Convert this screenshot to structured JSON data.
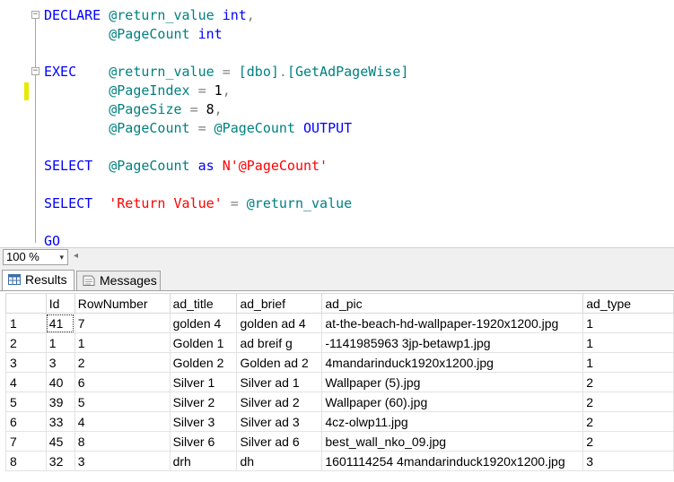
{
  "editor": {
    "lines": [
      {
        "parts": [
          [
            "kw",
            "DECLARE"
          ],
          [
            "t",
            " "
          ],
          [
            "var",
            "@return_value"
          ],
          [
            "t",
            " "
          ],
          [
            "kw",
            "int"
          ],
          [
            "gray",
            ","
          ]
        ]
      },
      {
        "parts": [
          [
            "t",
            "        "
          ],
          [
            "var",
            "@PageCount"
          ],
          [
            "t",
            " "
          ],
          [
            "kw",
            "int"
          ]
        ]
      },
      {
        "parts": [
          [
            "t",
            ""
          ]
        ]
      },
      {
        "parts": [
          [
            "kw",
            "EXEC"
          ],
          [
            "t",
            "    "
          ],
          [
            "var",
            "@return_value"
          ],
          [
            "t",
            " "
          ],
          [
            "gray",
            "="
          ],
          [
            "t",
            " "
          ],
          [
            "var",
            "[dbo]"
          ],
          [
            "gray",
            "."
          ],
          [
            "var",
            "[GetAdPageWise]"
          ]
        ]
      },
      {
        "parts": [
          [
            "t",
            "        "
          ],
          [
            "var",
            "@PageIndex"
          ],
          [
            "t",
            " "
          ],
          [
            "gray",
            "="
          ],
          [
            "t",
            " 1"
          ],
          [
            "gray",
            ","
          ]
        ]
      },
      {
        "parts": [
          [
            "t",
            "        "
          ],
          [
            "var",
            "@PageSize"
          ],
          [
            "t",
            " "
          ],
          [
            "gray",
            "="
          ],
          [
            "t",
            " 8"
          ],
          [
            "gray",
            ","
          ]
        ]
      },
      {
        "parts": [
          [
            "t",
            "        "
          ],
          [
            "var",
            "@PageCount"
          ],
          [
            "t",
            " "
          ],
          [
            "gray",
            "="
          ],
          [
            "t",
            " "
          ],
          [
            "var",
            "@PageCount"
          ],
          [
            "t",
            " "
          ],
          [
            "kw",
            "OUTPUT"
          ]
        ]
      },
      {
        "parts": [
          [
            "t",
            ""
          ]
        ]
      },
      {
        "parts": [
          [
            "kw",
            "SELECT"
          ],
          [
            "t",
            "  "
          ],
          [
            "var",
            "@PageCount"
          ],
          [
            "t",
            " "
          ],
          [
            "kw",
            "as"
          ],
          [
            "t",
            " "
          ],
          [
            "str",
            "N'@PageCount'"
          ]
        ]
      },
      {
        "parts": [
          [
            "t",
            ""
          ]
        ]
      },
      {
        "parts": [
          [
            "kw",
            "SELECT"
          ],
          [
            "t",
            "  "
          ],
          [
            "str",
            "'Return Value'"
          ],
          [
            "t",
            " "
          ],
          [
            "gray",
            "="
          ],
          [
            "t",
            " "
          ],
          [
            "var",
            "@return_value"
          ]
        ]
      },
      {
        "parts": [
          [
            "t",
            ""
          ]
        ]
      },
      {
        "parts": [
          [
            "kw",
            "GO"
          ]
        ]
      }
    ]
  },
  "zoom": {
    "value": "100 %",
    "arrow": "▾",
    "scroll_left": "◂"
  },
  "tabs": {
    "results": "Results",
    "messages": "Messages"
  },
  "grid": {
    "columns": [
      "Id",
      "RowNumber",
      "ad_title",
      "ad_brief",
      "ad_pic",
      "ad_type"
    ],
    "rows": [
      [
        "1",
        "41",
        "7",
        "golden 4",
        "golden ad 4",
        "at-the-beach-hd-wallpaper-1920x1200.jpg",
        "1"
      ],
      [
        "2",
        "1",
        "1",
        "Golden 1",
        "ad breif g",
        "-1141985963 3jp-betawp1.jpg",
        "1"
      ],
      [
        "3",
        "3",
        "2",
        "Golden 2",
        "Golden ad 2",
        "4mandarinduck1920x1200.jpg",
        "1"
      ],
      [
        "4",
        "40",
        "6",
        "Silver 1",
        "Silver ad 1",
        "Wallpaper (5).jpg",
        "2"
      ],
      [
        "5",
        "39",
        "5",
        "Silver 2",
        "Silver ad 2",
        "Wallpaper (60).jpg",
        "2"
      ],
      [
        "6",
        "33",
        "4",
        "Silver 3",
        "Silver ad 3",
        "4cz-olwp11.jpg",
        "2"
      ],
      [
        "7",
        "45",
        "8",
        "Silver 6",
        "Silver ad 6",
        "best_wall_nko_09.jpg",
        "2"
      ],
      [
        "8",
        "32",
        "3",
        "drh",
        "dh",
        "1601114254 4mandarinduck1920x1200.jpg",
        "3"
      ]
    ]
  }
}
